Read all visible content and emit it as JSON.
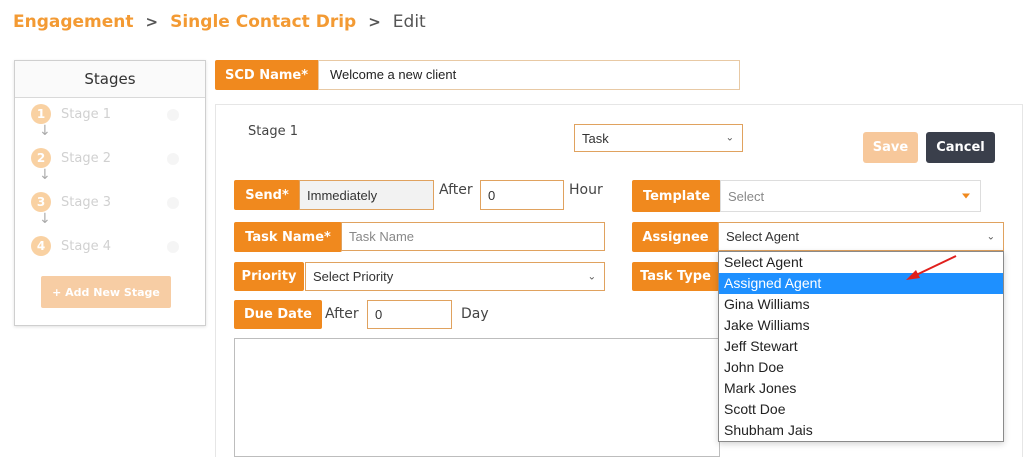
{
  "breadcrumb": {
    "items": [
      "Engagement",
      "Single Contact Drip"
    ],
    "separator": ">",
    "current": "Edit"
  },
  "stages": {
    "title": "Stages",
    "items": [
      {
        "num": "1",
        "label": "Stage 1"
      },
      {
        "num": "2",
        "label": "Stage 2"
      },
      {
        "num": "3",
        "label": "Stage 3"
      },
      {
        "num": "4",
        "label": "Stage 4"
      }
    ],
    "add_button": "+ Add New Stage"
  },
  "scd": {
    "label": "SCD Name*",
    "value": "Welcome a new client"
  },
  "form": {
    "stage_title": "Stage 1",
    "type_select": "Task",
    "save": "Save",
    "cancel": "Cancel",
    "send_label": "Send*",
    "send_value": "Immediately",
    "after_label": "After",
    "after_value": "0",
    "hour_label": "Hour",
    "template_label": "Template",
    "template_placeholder": "Select",
    "task_name_label": "Task Name*",
    "task_name_placeholder": "Task Name",
    "assignee_label": "Assignee",
    "assignee_value": "Select Agent",
    "priority_label": "Priority",
    "priority_value": "Select Priority",
    "task_type_label": "Task Type",
    "due_date_label": "Due Date",
    "due_after_label": "After",
    "due_after_value": "0",
    "day_label": "Day"
  },
  "assignee_dropdown": {
    "options": [
      "Select Agent",
      "Assigned Agent",
      "Gina Williams",
      "Jake Williams",
      "Jeff Stewart",
      "John Doe",
      "Mark Jones",
      "Scott Doe",
      "Shubham Jais"
    ],
    "highlighted": "Assigned Agent"
  },
  "colors": {
    "accent": "#f0891e",
    "breadcrumb": "#f39a33",
    "highlight": "#1e90ff",
    "cancel": "#3a3f4b",
    "annotation_arrow": "#e0201d"
  }
}
